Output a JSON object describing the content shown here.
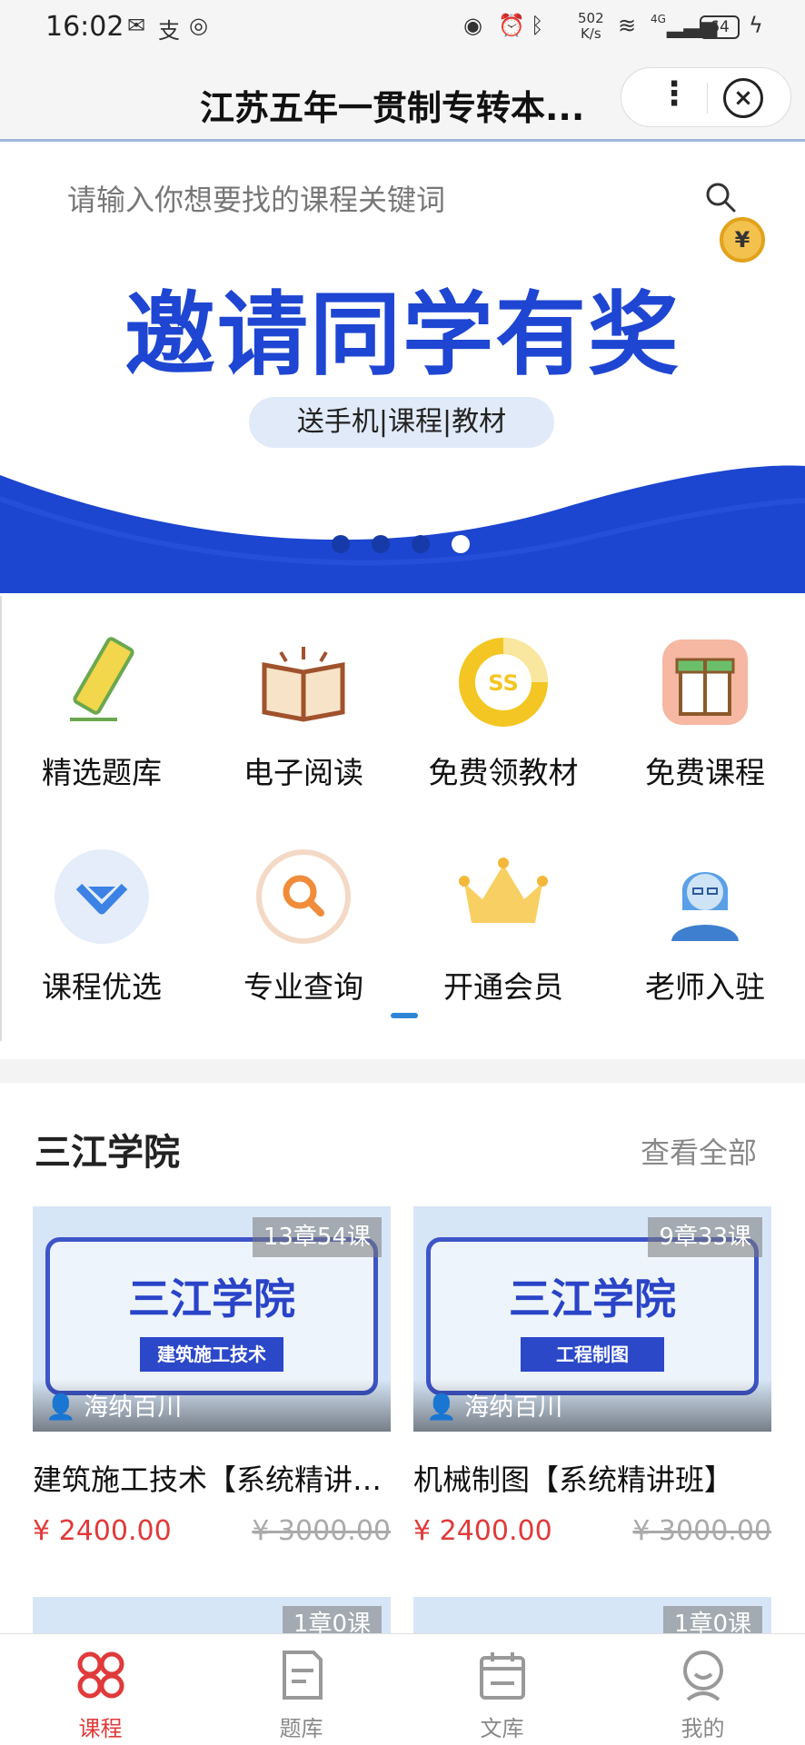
{
  "status_bar": {
    "time": "16:02",
    "net_speed_value": "502",
    "net_speed_unit": "K/s",
    "network": "4G",
    "battery": "64"
  },
  "header": {
    "title": "江苏五年一贯制专转本..."
  },
  "banner": {
    "search_placeholder": "请输入你想要找的课程关键词",
    "coin_symbol": "¥",
    "headline": "邀请同学有奖",
    "subline": "送手机|课程|教材",
    "slides_total": 4,
    "slide_active": 4,
    "colors": {
      "headline": "#1e46d2",
      "wave": "#1c45d0",
      "pill": "#e1eaf8"
    }
  },
  "quick_links": [
    {
      "label": "精选题库",
      "icon": "pencil-icon"
    },
    {
      "label": "电子阅读",
      "icon": "open-book-icon"
    },
    {
      "label": "免费领教材",
      "icon": "coin-chart-icon"
    },
    {
      "label": "免费课程",
      "icon": "gift-icon"
    },
    {
      "label": "课程优选",
      "icon": "diamond-icon"
    },
    {
      "label": "专业查询",
      "icon": "magnifier-icon"
    },
    {
      "label": "开通会员",
      "icon": "crown-icon"
    },
    {
      "label": "老师入驻",
      "icon": "teacher-icon"
    }
  ],
  "section": {
    "title": "三江学院",
    "more": "查看全部",
    "courses": [
      {
        "thumb_brand": "三江学院",
        "thumb_tag": "建筑施工技术",
        "count": "13章54课",
        "author": "海纳百川",
        "title": "建筑施工技术【系统精讲班】",
        "price": "¥ 2400.00",
        "original_price": "¥ 3000.00"
      },
      {
        "thumb_brand": "三江学院",
        "thumb_tag": "工程制图",
        "count": "9章33课",
        "author": "海纳百川",
        "title": "机械制图【系统精讲班】",
        "price": "¥ 2400.00",
        "original_price": "¥ 3000.00"
      }
    ],
    "next_row": [
      {
        "count": "1章0课"
      },
      {
        "count": "1章0课"
      }
    ]
  },
  "tabbar": [
    {
      "label": "课程",
      "icon": "course-icon",
      "active": true
    },
    {
      "label": "题库",
      "icon": "question-bank-icon",
      "active": false
    },
    {
      "label": "文库",
      "icon": "library-icon",
      "active": false
    },
    {
      "label": "我的",
      "icon": "profile-icon",
      "active": false
    }
  ],
  "colors": {
    "accent": "#e03a3a",
    "link_blue": "#2f86d6"
  }
}
